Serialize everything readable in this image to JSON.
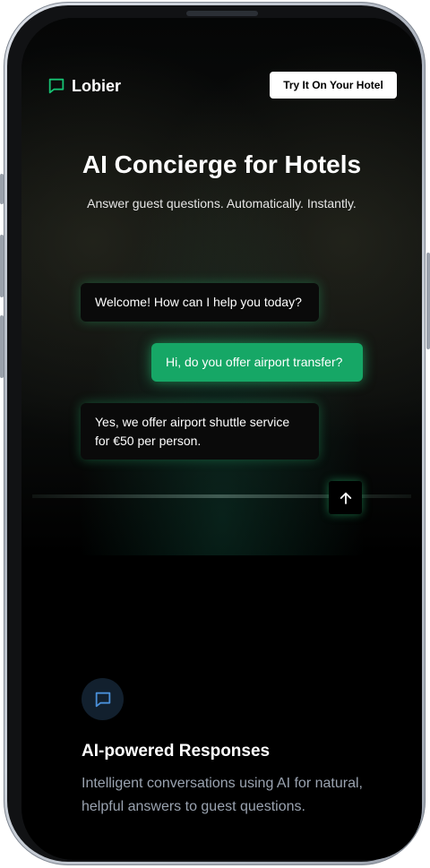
{
  "header": {
    "brand": "Lobier",
    "cta_label": "Try It On Your Hotel"
  },
  "hero": {
    "title": "AI Concierge for Hotels",
    "subtitle": "Answer guest questions. Automatically. Instantly."
  },
  "chat": {
    "messages": [
      {
        "role": "assistant",
        "text": "Welcome! How can I help you today?"
      },
      {
        "role": "user",
        "text": "Hi, do you offer airport transfer?"
      },
      {
        "role": "assistant",
        "text": "Yes, we offer airport shuttle service for €50 per person."
      }
    ]
  },
  "feature": {
    "icon": "message-square-icon",
    "title": "AI-powered Responses",
    "description": "Intelligent conversations using AI for natural, helpful answers to guest questions."
  },
  "colors": {
    "brand_green": "#16a766",
    "feature_icon_blue": "#4a8fd8"
  }
}
